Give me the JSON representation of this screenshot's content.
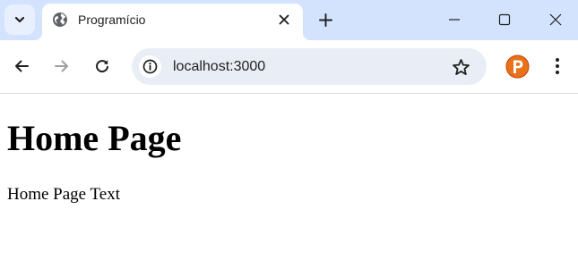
{
  "browser": {
    "tab": {
      "title": "Programício",
      "favicon": "globe-icon"
    },
    "icons": {
      "tab_search": "chevron-down-icon",
      "tab_close": "close-icon",
      "new_tab": "plus-icon",
      "minimize": "minimize-icon",
      "maximize": "maximize-icon",
      "window_close": "close-icon",
      "back": "arrow-left-icon",
      "forward": "arrow-right-icon",
      "reload": "reload-icon",
      "site_info": "info-icon",
      "bookmark": "star-icon",
      "extension": "extension-p-icon",
      "menu": "more-vertical-icon"
    },
    "omnibox": {
      "url": "localhost:3000"
    },
    "extension": {
      "letter": "P"
    },
    "colors": {
      "tabstrip_bg": "#d3e3fd",
      "omnibox_bg": "#e9eef6",
      "extension_bg": "#e8711a"
    }
  },
  "page": {
    "heading": "Home Page",
    "text": "Home Page Text"
  }
}
